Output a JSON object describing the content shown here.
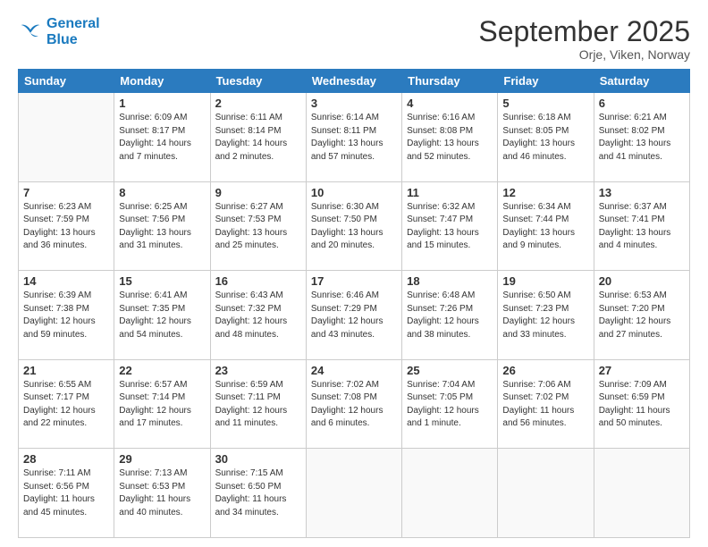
{
  "header": {
    "logo_line1": "General",
    "logo_line2": "Blue",
    "month": "September 2025",
    "location": "Orje, Viken, Norway"
  },
  "weekdays": [
    "Sunday",
    "Monday",
    "Tuesday",
    "Wednesday",
    "Thursday",
    "Friday",
    "Saturday"
  ],
  "weeks": [
    [
      {
        "day": "",
        "sunrise": "",
        "sunset": "",
        "daylight": ""
      },
      {
        "day": "1",
        "sunrise": "6:09 AM",
        "sunset": "8:17 PM",
        "daylight": "14 hours and 7 minutes."
      },
      {
        "day": "2",
        "sunrise": "6:11 AM",
        "sunset": "8:14 PM",
        "daylight": "14 hours and 2 minutes."
      },
      {
        "day": "3",
        "sunrise": "6:14 AM",
        "sunset": "8:11 PM",
        "daylight": "13 hours and 57 minutes."
      },
      {
        "day": "4",
        "sunrise": "6:16 AM",
        "sunset": "8:08 PM",
        "daylight": "13 hours and 52 minutes."
      },
      {
        "day": "5",
        "sunrise": "6:18 AM",
        "sunset": "8:05 PM",
        "daylight": "13 hours and 46 minutes."
      },
      {
        "day": "6",
        "sunrise": "6:21 AM",
        "sunset": "8:02 PM",
        "daylight": "13 hours and 41 minutes."
      }
    ],
    [
      {
        "day": "7",
        "sunrise": "6:23 AM",
        "sunset": "7:59 PM",
        "daylight": "13 hours and 36 minutes."
      },
      {
        "day": "8",
        "sunrise": "6:25 AM",
        "sunset": "7:56 PM",
        "daylight": "13 hours and 31 minutes."
      },
      {
        "day": "9",
        "sunrise": "6:27 AM",
        "sunset": "7:53 PM",
        "daylight": "13 hours and 25 minutes."
      },
      {
        "day": "10",
        "sunrise": "6:30 AM",
        "sunset": "7:50 PM",
        "daylight": "13 hours and 20 minutes."
      },
      {
        "day": "11",
        "sunrise": "6:32 AM",
        "sunset": "7:47 PM",
        "daylight": "13 hours and 15 minutes."
      },
      {
        "day": "12",
        "sunrise": "6:34 AM",
        "sunset": "7:44 PM",
        "daylight": "13 hours and 9 minutes."
      },
      {
        "day": "13",
        "sunrise": "6:37 AM",
        "sunset": "7:41 PM",
        "daylight": "13 hours and 4 minutes."
      }
    ],
    [
      {
        "day": "14",
        "sunrise": "6:39 AM",
        "sunset": "7:38 PM",
        "daylight": "12 hours and 59 minutes."
      },
      {
        "day": "15",
        "sunrise": "6:41 AM",
        "sunset": "7:35 PM",
        "daylight": "12 hours and 54 minutes."
      },
      {
        "day": "16",
        "sunrise": "6:43 AM",
        "sunset": "7:32 PM",
        "daylight": "12 hours and 48 minutes."
      },
      {
        "day": "17",
        "sunrise": "6:46 AM",
        "sunset": "7:29 PM",
        "daylight": "12 hours and 43 minutes."
      },
      {
        "day": "18",
        "sunrise": "6:48 AM",
        "sunset": "7:26 PM",
        "daylight": "12 hours and 38 minutes."
      },
      {
        "day": "19",
        "sunrise": "6:50 AM",
        "sunset": "7:23 PM",
        "daylight": "12 hours and 33 minutes."
      },
      {
        "day": "20",
        "sunrise": "6:53 AM",
        "sunset": "7:20 PM",
        "daylight": "12 hours and 27 minutes."
      }
    ],
    [
      {
        "day": "21",
        "sunrise": "6:55 AM",
        "sunset": "7:17 PM",
        "daylight": "12 hours and 22 minutes."
      },
      {
        "day": "22",
        "sunrise": "6:57 AM",
        "sunset": "7:14 PM",
        "daylight": "12 hours and 17 minutes."
      },
      {
        "day": "23",
        "sunrise": "6:59 AM",
        "sunset": "7:11 PM",
        "daylight": "12 hours and 11 minutes."
      },
      {
        "day": "24",
        "sunrise": "7:02 AM",
        "sunset": "7:08 PM",
        "daylight": "12 hours and 6 minutes."
      },
      {
        "day": "25",
        "sunrise": "7:04 AM",
        "sunset": "7:05 PM",
        "daylight": "12 hours and 1 minute."
      },
      {
        "day": "26",
        "sunrise": "7:06 AM",
        "sunset": "7:02 PM",
        "daylight": "11 hours and 56 minutes."
      },
      {
        "day": "27",
        "sunrise": "7:09 AM",
        "sunset": "6:59 PM",
        "daylight": "11 hours and 50 minutes."
      }
    ],
    [
      {
        "day": "28",
        "sunrise": "7:11 AM",
        "sunset": "6:56 PM",
        "daylight": "11 hours and 45 minutes."
      },
      {
        "day": "29",
        "sunrise": "7:13 AM",
        "sunset": "6:53 PM",
        "daylight": "11 hours and 40 minutes."
      },
      {
        "day": "30",
        "sunrise": "7:15 AM",
        "sunset": "6:50 PM",
        "daylight": "11 hours and 34 minutes."
      },
      {
        "day": "",
        "sunrise": "",
        "sunset": "",
        "daylight": ""
      },
      {
        "day": "",
        "sunrise": "",
        "sunset": "",
        "daylight": ""
      },
      {
        "day": "",
        "sunrise": "",
        "sunset": "",
        "daylight": ""
      },
      {
        "day": "",
        "sunrise": "",
        "sunset": "",
        "daylight": ""
      }
    ]
  ],
  "labels": {
    "sunrise_prefix": "Sunrise: ",
    "sunset_prefix": "Sunset: ",
    "daylight_prefix": "Daylight: "
  }
}
